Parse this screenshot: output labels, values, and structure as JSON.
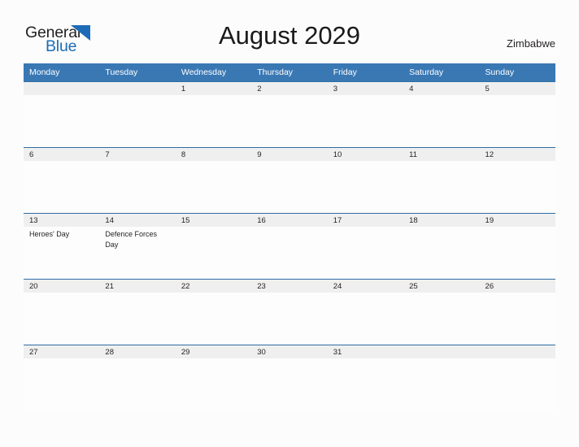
{
  "brand": {
    "name_part1": "General",
    "name_part2": "Blue",
    "logo_icon": "blue-triangle-flag-icon",
    "color_dark": "#231f20",
    "color_blue": "#1e6bb8"
  },
  "header": {
    "title": "August 2029",
    "country": "Zimbabwe"
  },
  "theme": {
    "header_row_bg": "#3a78b4",
    "daynum_band_bg": "#efefef",
    "daynum_band_border": "#2e6da4",
    "page_bg": "#fcfcfc",
    "text": "#231f20"
  },
  "calendar": {
    "month": "August",
    "year": "2029",
    "weekday_headers": [
      "Monday",
      "Tuesday",
      "Wednesday",
      "Thursday",
      "Friday",
      "Saturday",
      "Sunday"
    ],
    "weeks": [
      [
        {
          "day": "",
          "events": []
        },
        {
          "day": "",
          "events": []
        },
        {
          "day": "1",
          "events": []
        },
        {
          "day": "2",
          "events": []
        },
        {
          "day": "3",
          "events": []
        },
        {
          "day": "4",
          "events": []
        },
        {
          "day": "5",
          "events": []
        }
      ],
      [
        {
          "day": "6",
          "events": []
        },
        {
          "day": "7",
          "events": []
        },
        {
          "day": "8",
          "events": []
        },
        {
          "day": "9",
          "events": []
        },
        {
          "day": "10",
          "events": []
        },
        {
          "day": "11",
          "events": []
        },
        {
          "day": "12",
          "events": []
        }
      ],
      [
        {
          "day": "13",
          "events": [
            "Heroes' Day"
          ]
        },
        {
          "day": "14",
          "events": [
            "Defence Forces Day"
          ]
        },
        {
          "day": "15",
          "events": []
        },
        {
          "day": "16",
          "events": []
        },
        {
          "day": "17",
          "events": []
        },
        {
          "day": "18",
          "events": []
        },
        {
          "day": "19",
          "events": []
        }
      ],
      [
        {
          "day": "20",
          "events": []
        },
        {
          "day": "21",
          "events": []
        },
        {
          "day": "22",
          "events": []
        },
        {
          "day": "23",
          "events": []
        },
        {
          "day": "24",
          "events": []
        },
        {
          "day": "25",
          "events": []
        },
        {
          "day": "26",
          "events": []
        }
      ],
      [
        {
          "day": "27",
          "events": []
        },
        {
          "day": "28",
          "events": []
        },
        {
          "day": "29",
          "events": []
        },
        {
          "day": "30",
          "events": []
        },
        {
          "day": "31",
          "events": []
        },
        {
          "day": "",
          "events": []
        },
        {
          "day": "",
          "events": []
        }
      ]
    ]
  }
}
